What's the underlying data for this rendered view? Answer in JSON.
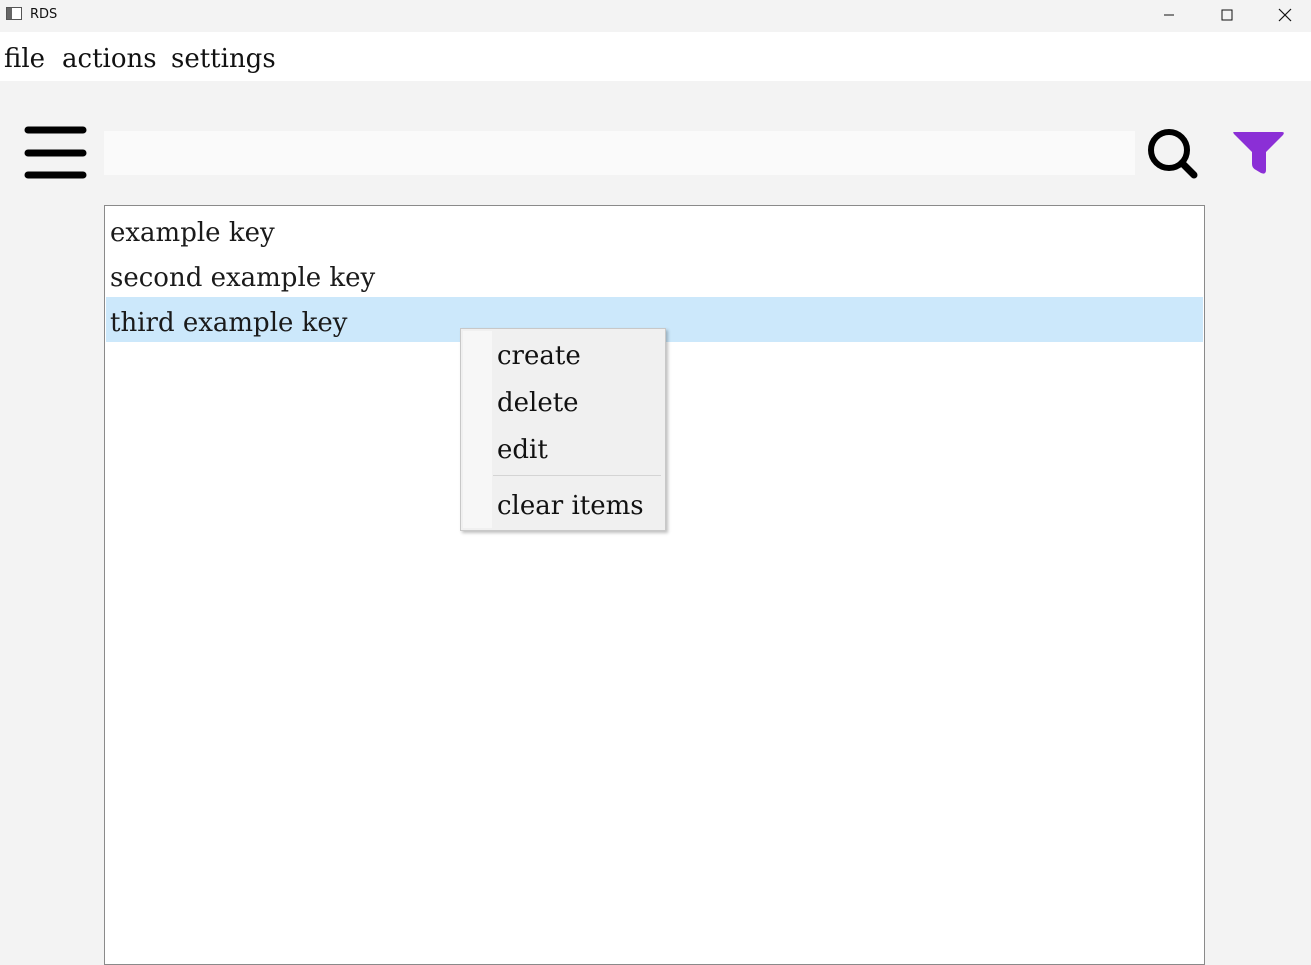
{
  "window": {
    "title": "RDS",
    "controls": [
      "minimize-icon",
      "maximize-icon",
      "close-icon"
    ]
  },
  "menubar": {
    "items": [
      "file",
      "actions",
      "settings"
    ]
  },
  "toolbar": {
    "menu_icon": "hamburger-icon",
    "search_value": "",
    "search_icon": "search-icon",
    "filter_icon": "filter-icon",
    "filter_color": "#8b2fd6"
  },
  "list": {
    "items": [
      {
        "label": "example key",
        "selected": false
      },
      {
        "label": "second example key",
        "selected": false
      },
      {
        "label": "third example key",
        "selected": true
      }
    ],
    "selection_color": "#cce8fb"
  },
  "context_menu": {
    "items": [
      "create",
      "delete",
      "edit"
    ],
    "footer_item": "clear items"
  }
}
